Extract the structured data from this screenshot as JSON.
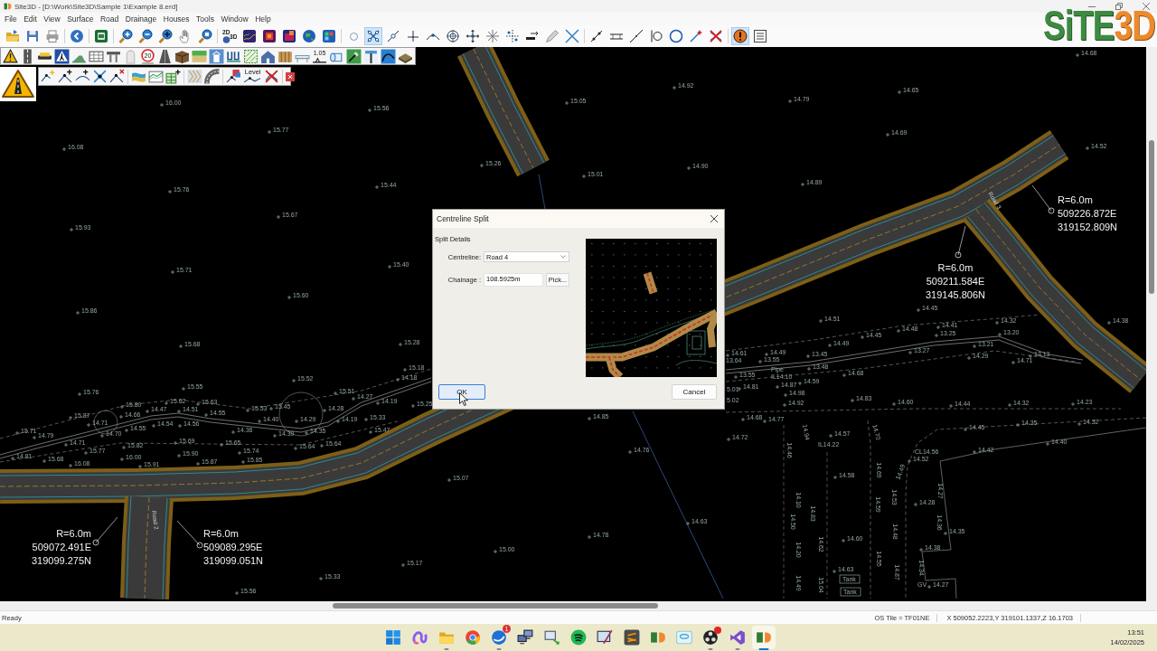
{
  "window": {
    "title": "Site3D - [D:\\Work\\Site3D\\Sample 1\\Example 8.erd]"
  },
  "logo": {
    "parts": [
      "SiTE",
      "3D"
    ]
  },
  "menu": [
    "File",
    "Edit",
    "View",
    "Surface",
    "Road",
    "Drainage",
    "Houses",
    "Tools",
    "Window",
    "Help"
  ],
  "toolbars": [
    {
      "captions": [
        "2D",
        "3D"
      ],
      "buttons": [
        {
          "pressed": false
        },
        {
          "pressed": false
        },
        {
          "pressed": false
        },
        {
          "pressed": false
        },
        {
          "pressed": false
        },
        {
          "pressed": false
        },
        {
          "pressed": false
        },
        {
          "pressed": false
        },
        {
          "pressed": false
        },
        {
          "pressed": false
        },
        {
          "pressed": false
        },
        {
          "pressed": false
        },
        {
          "pressed": false
        },
        {
          "pressed": false
        },
        {
          "pressed": false
        },
        {
          "pressed": false
        },
        {
          "pressed": false
        },
        {
          "pressed": true
        },
        {
          "pressed": false
        },
        {
          "pressed": false
        },
        {
          "pressed": false
        },
        {
          "pressed": false
        },
        {
          "pressed": false
        },
        {
          "pressed": false
        },
        {
          "pressed": false
        },
        {
          "pressed": false
        },
        {
          "pressed": false
        },
        {
          "pressed": false
        },
        {
          "pressed": false
        },
        {
          "pressed": false
        },
        {
          "pressed": false
        },
        {
          "pressed": false
        },
        {
          "pressed": false
        },
        {
          "pressed": false
        },
        {
          "pressed": false
        },
        {
          "pressed": true
        },
        {
          "pressed": false
        }
      ]
    },
    {
      "captions": [
        "20",
        "1.05"
      ]
    },
    {
      "captions": [
        "Level"
      ]
    }
  ],
  "canvas": {
    "spot_heights": [
      "14.68",
      "14.92",
      "14.65",
      "16.00",
      "15.05",
      "14.79",
      "15.56",
      "15.77",
      "14.69",
      "16.08",
      "14.52",
      "15.26",
      "14.90",
      "15.01",
      "15.44",
      "14.89",
      "15.76",
      "15.67",
      "15.93",
      "15.40",
      "15.71",
      "15.60",
      "15.86",
      "14.45",
      "14.51",
      "14.32",
      "14.38",
      "14.45",
      "14.48",
      "13.25",
      "14.41",
      "13.20",
      "15.68",
      "15.28",
      "14.49",
      "13.21",
      "14.61",
      "13.64",
      "14.49",
      "13.55",
      "13.45",
      "13.27",
      "14.29",
      "14.71",
      "13.13",
      "15.18",
      "13.48",
      "15.52",
      "14.18",
      "13.55",
      "14.59",
      "14.68",
      "15.76",
      "15.55",
      "15.51",
      "5.01",
      "14.81",
      "14.87",
      "14.98",
      "15.80",
      "14.47",
      "15.62",
      "14.51",
      "15.63",
      "15.53",
      "15.45",
      "14.28",
      "14.27",
      "14.19",
      "15.25",
      "5.02",
      "14.92",
      "14.83",
      "14.60",
      "14.44",
      "14.32",
      "14.23",
      "15.87",
      "14.71",
      "14.66",
      "14.54",
      "14.56",
      "14.55",
      "14.40",
      "14.29",
      "14.19",
      "15.33",
      "14.85",
      "14.68",
      "14.77",
      "14.35",
      "14.32",
      "15.71",
      "14.79",
      "14.70",
      "14.55",
      "14.36",
      "14.39",
      "14.35",
      "15.47",
      "14.72",
      "14.57",
      "14.45",
      "14.71",
      "15.82",
      "15.69",
      "15.65",
      "15.64",
      "15.64",
      "14.40",
      "14.81",
      "15.68",
      "16.08",
      "15.77",
      "16.00",
      "15.91",
      "15.90",
      "15.87",
      "15.74",
      "15.85",
      "14.76",
      "14.52",
      "14.42",
      "15.07",
      "14.58",
      "14.28",
      "14.63",
      "14.78",
      "14.60",
      "14.35",
      "15.00",
      "14.38",
      "15.17",
      "14.63",
      "15.33",
      "14.27",
      "15.56"
    ],
    "vertical_spot_heights": [
      "14.46",
      "14.50",
      "14.10",
      "14.20",
      "14.49",
      "14.94",
      "14.83",
      "14.62",
      "15.04",
      "14.70",
      "14.69",
      "14.59",
      "14.55",
      "14.49",
      "14.53",
      "14.48",
      "14.87",
      "14.34",
      "14.27",
      "14.36"
    ],
    "notes": [
      "Pipe",
      "IL14.10",
      "IL14.22",
      "CL14.56",
      "Tank",
      "GV",
      "Tank"
    ],
    "radius_labels": [
      {
        "lines": [
          "R=6.0m",
          "509226.872E",
          "319152.809N"
        ]
      },
      {
        "lines": [
          "R=6.0m",
          "509211.584E",
          "319145.806N"
        ]
      },
      {
        "lines": [
          "R=6.0m",
          "509072.491E",
          "319099.275N"
        ]
      },
      {
        "lines": [
          "R=6.0m",
          "509089.295E",
          "319099.051N"
        ]
      }
    ],
    "road_labels": [
      "Road 3",
      "Road 2"
    ]
  },
  "dialog": {
    "title": "Centreline Split",
    "group": "Split Details",
    "fields": [
      {
        "kind": "dropdown",
        "label": "Centreline:",
        "value": "Road 4"
      },
      {
        "kind": "text",
        "label": "Chainage :",
        "value": "108.5925m",
        "button": "Pick..."
      }
    ],
    "buttons": [
      {
        "label": "OK",
        "focused": true
      },
      {
        "label": "Cancel",
        "focused": false
      }
    ]
  },
  "status_bar": {
    "message": "Ready",
    "tile": "OS Tile = TF01NE",
    "coordinates": "X 509052.2223,Y 319101.1337,Z 16.1703"
  },
  "taskbar": {
    "apps": [
      {
        "running": false,
        "selected": false,
        "dot": false
      },
      {
        "running": false,
        "selected": false,
        "dot": false
      },
      {
        "running": true,
        "selected": false,
        "dot": false
      },
      {
        "running": false,
        "selected": false,
        "dot": false
      },
      {
        "running": true,
        "selected": false,
        "dot": false,
        "badge": "1"
      },
      {
        "running": false,
        "selected": false,
        "dot": false
      },
      {
        "running": false,
        "selected": false,
        "dot": false
      },
      {
        "running": false,
        "selected": false,
        "dot": false
      },
      {
        "running": false,
        "selected": false,
        "dot": false
      },
      {
        "running": false,
        "selected": false,
        "dot": false
      },
      {
        "running": false,
        "selected": false,
        "dot": false
      },
      {
        "running": false,
        "selected": false,
        "dot": false
      },
      {
        "running": true,
        "selected": false,
        "dot": true
      },
      {
        "running": true,
        "selected": false,
        "dot": false
      },
      {
        "running": true,
        "selected": true,
        "dot": false
      }
    ],
    "clock": {
      "time": "13:51",
      "date": "14/02/2025"
    }
  }
}
